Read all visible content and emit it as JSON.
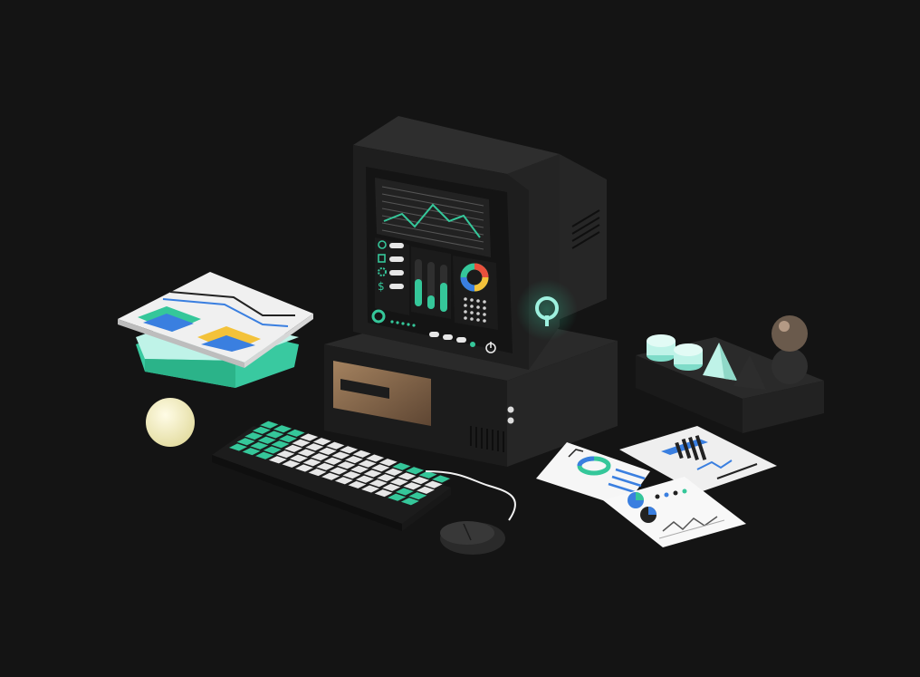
{
  "scene": {
    "description_tag": "isometric-retro-computer",
    "colors": {
      "background": "#141414",
      "body_dark": "#1e1e1e",
      "body_mid": "#2a2a2a",
      "body_light": "#343434",
      "accent_green": "#35c79a",
      "accent_teal": "#9ef1df",
      "accent_blue": "#3a7fe0",
      "accent_yellow": "#f3c23a",
      "accent_red": "#e8503c",
      "paper": "#f2f2f2",
      "key_white": "#e7e7e7",
      "floppy_copper": "#8a6a4e",
      "orb": "#f6f2c8"
    },
    "icons": [
      "timer-icon",
      "trash-icon",
      "gear-icon",
      "dollar-icon",
      "power-icon",
      "ring-logo-icon"
    ]
  }
}
